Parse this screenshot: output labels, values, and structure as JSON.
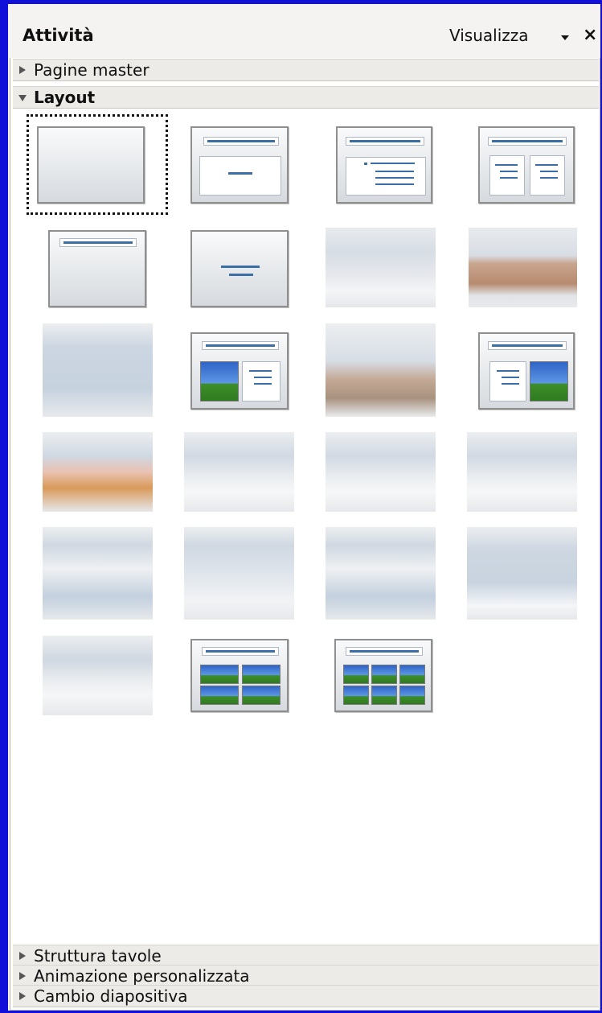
{
  "panel": {
    "title": "Attività",
    "view_label": "Visualizza",
    "close_symbol": "×"
  },
  "sections": {
    "master": "Pagine master",
    "layout": "Layout",
    "table": "Struttura tavole",
    "animation": "Animazione personalizzata",
    "transition": "Cambio diapositiva"
  },
  "colors": {
    "window_border": "#1010d8",
    "accent_line": "#3c6ea6",
    "header_bg": "#ecebe8"
  }
}
